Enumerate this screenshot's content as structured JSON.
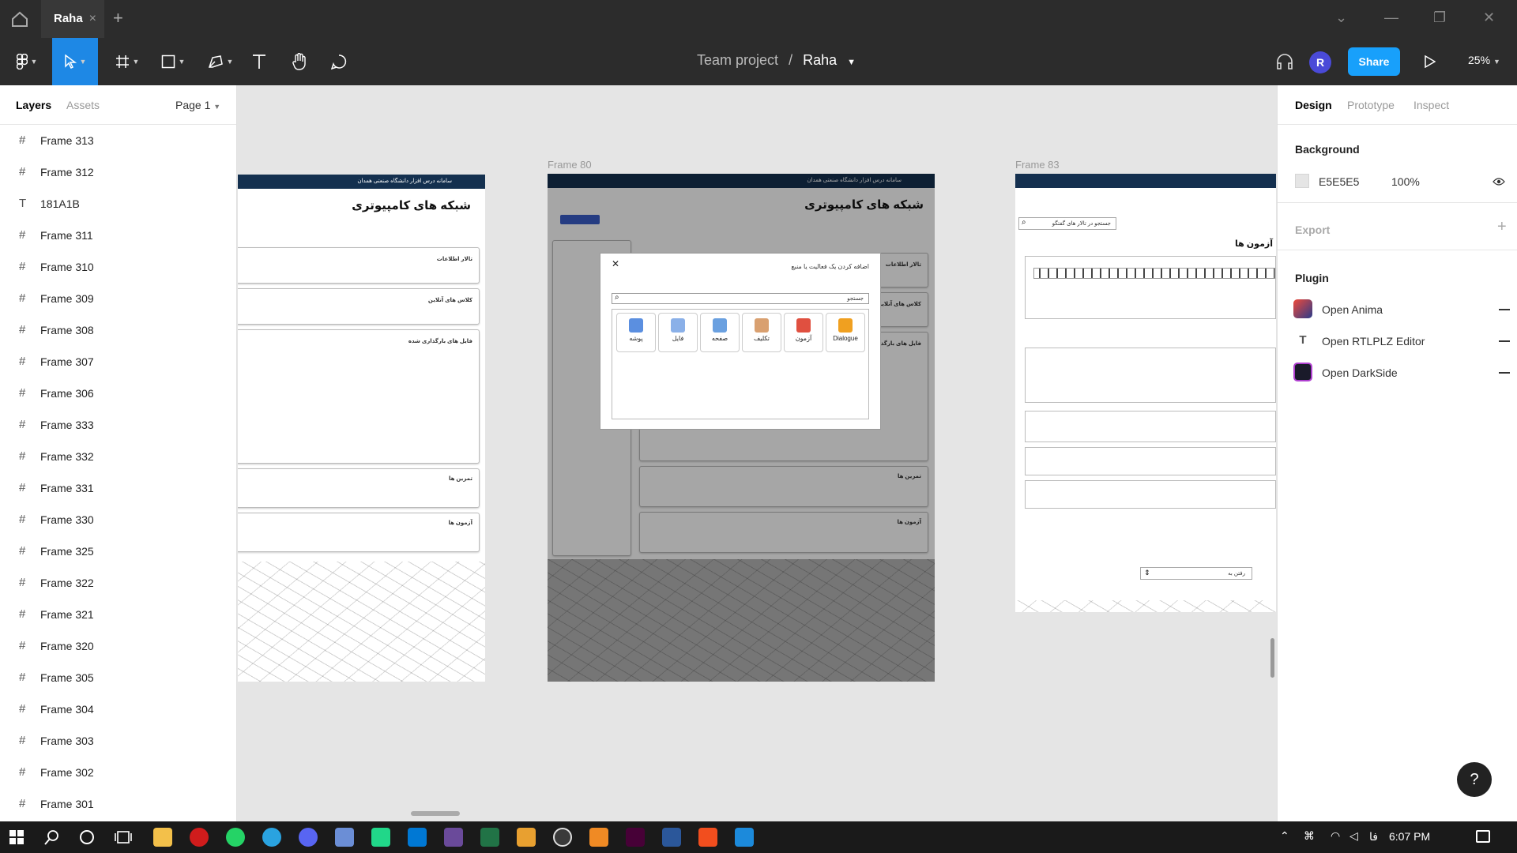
{
  "tabs": {
    "home_icon": "home-icon",
    "active_tab": "Raha",
    "close": "×",
    "new_tab": "+"
  },
  "window_controls": {
    "chevron": "⌄",
    "minimize": "—",
    "maximize": "❐",
    "close": "✕"
  },
  "toolbar": {
    "breadcrumb_project": "Team project",
    "breadcrumb_sep": "/",
    "breadcrumb_file": "Raha",
    "avatar_letter": "R",
    "share_label": "Share",
    "zoom": "25%"
  },
  "layers_panel": {
    "tab_layers": "Layers",
    "tab_assets": "Assets",
    "page": "Page 1",
    "items": [
      {
        "name": "Frame 313",
        "kind": "frame"
      },
      {
        "name": "Frame 312",
        "kind": "frame"
      },
      {
        "name": "181A1B",
        "kind": "text"
      },
      {
        "name": "Frame 311",
        "kind": "frame"
      },
      {
        "name": "Frame 310",
        "kind": "frame"
      },
      {
        "name": "Frame 309",
        "kind": "frame"
      },
      {
        "name": "Frame 308",
        "kind": "frame"
      },
      {
        "name": "Frame 307",
        "kind": "frame"
      },
      {
        "name": "Frame 306",
        "kind": "frame"
      },
      {
        "name": "Frame 333",
        "kind": "frame"
      },
      {
        "name": "Frame 332",
        "kind": "frame"
      },
      {
        "name": "Frame 331",
        "kind": "frame"
      },
      {
        "name": "Frame 330",
        "kind": "frame"
      },
      {
        "name": "Frame 325",
        "kind": "frame"
      },
      {
        "name": "Frame 322",
        "kind": "frame"
      },
      {
        "name": "Frame 321",
        "kind": "frame"
      },
      {
        "name": "Frame 320",
        "kind": "frame"
      },
      {
        "name": "Frame 305",
        "kind": "frame"
      },
      {
        "name": "Frame 304",
        "kind": "frame"
      },
      {
        "name": "Frame 303",
        "kind": "frame"
      },
      {
        "name": "Frame 302",
        "kind": "frame"
      },
      {
        "name": "Frame 301",
        "kind": "frame"
      }
    ]
  },
  "design_panel": {
    "tab_design": "Design",
    "tab_prototype": "Prototype",
    "tab_inspect": "Inspect",
    "background_label": "Background",
    "background_hex": "E5E5E5",
    "background_opacity": "100%",
    "export_label": "Export",
    "plugin_label": "Plugin",
    "plugins": [
      "Open Anima",
      "Open RTLPLZ Editor",
      "Open DarkSide"
    ],
    "help": "?"
  },
  "canvas": {
    "frame80_label": "Frame 80",
    "frame83_label": "Frame 83",
    "site_title": "سامانه درس افزار دانشگاه صنعتی همدان",
    "course_title": "شبکه های کامپیوتری",
    "news_forum": "تالار اطلاعات",
    "online_class": "کلاس های آنلاین",
    "uploaded_files": "فایل های بارگذاری شده",
    "exercises": "تمرین ها",
    "quizzes": "آزمون ها",
    "modal_title": "اضافه کردن یک فعالیت یا منبع",
    "modal_search": "جستجو",
    "modal_close": "✕",
    "activities": [
      "Dialogue",
      "آزمون",
      "تکلیف",
      "صفحه",
      "فایل",
      "پوشه"
    ],
    "forum_search": "جستجو در تالار های گفتگو",
    "goto": "رفتن به"
  },
  "taskbar": {
    "lang": "فا",
    "time": "6:07 PM"
  },
  "colors": {
    "accent": "#18a0fb",
    "active_tool": "#1e88e5",
    "header_navy": "#14304f"
  }
}
